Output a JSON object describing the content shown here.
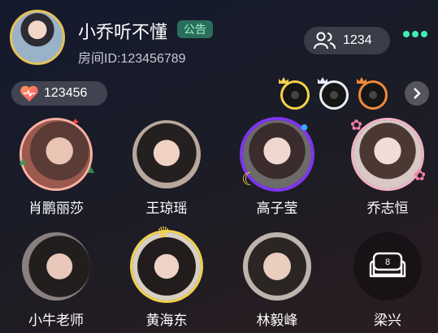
{
  "header": {
    "room_name": "小乔听不懂",
    "notice_label": "公告",
    "room_id": "房间ID:123456789",
    "members_count": "1234"
  },
  "heat": {
    "value": "123456"
  },
  "top_ranks": [
    "crown-gold",
    "crown-white",
    "crown-orange"
  ],
  "seats": [
    {
      "name": "肖鹏丽莎",
      "frame": "christmas-frame"
    },
    {
      "name": "王琼瑶",
      "frame": "none"
    },
    {
      "name": "高子莹",
      "frame": "moon-planet-frame"
    },
    {
      "name": "乔志恒",
      "frame": "flower-frame"
    },
    {
      "name": "小牛老师",
      "frame": "none"
    },
    {
      "name": "黄海东",
      "frame": "gold-crown-frame"
    },
    {
      "name": "林毅峰",
      "frame": "none"
    },
    {
      "name": "梁兴",
      "frame": "empty-seat",
      "seat_number": "8"
    }
  ],
  "colors": {
    "accent_green": "#3ef0b0",
    "notice_bg": "#2a6e5a",
    "gold": "#e6c15a"
  }
}
